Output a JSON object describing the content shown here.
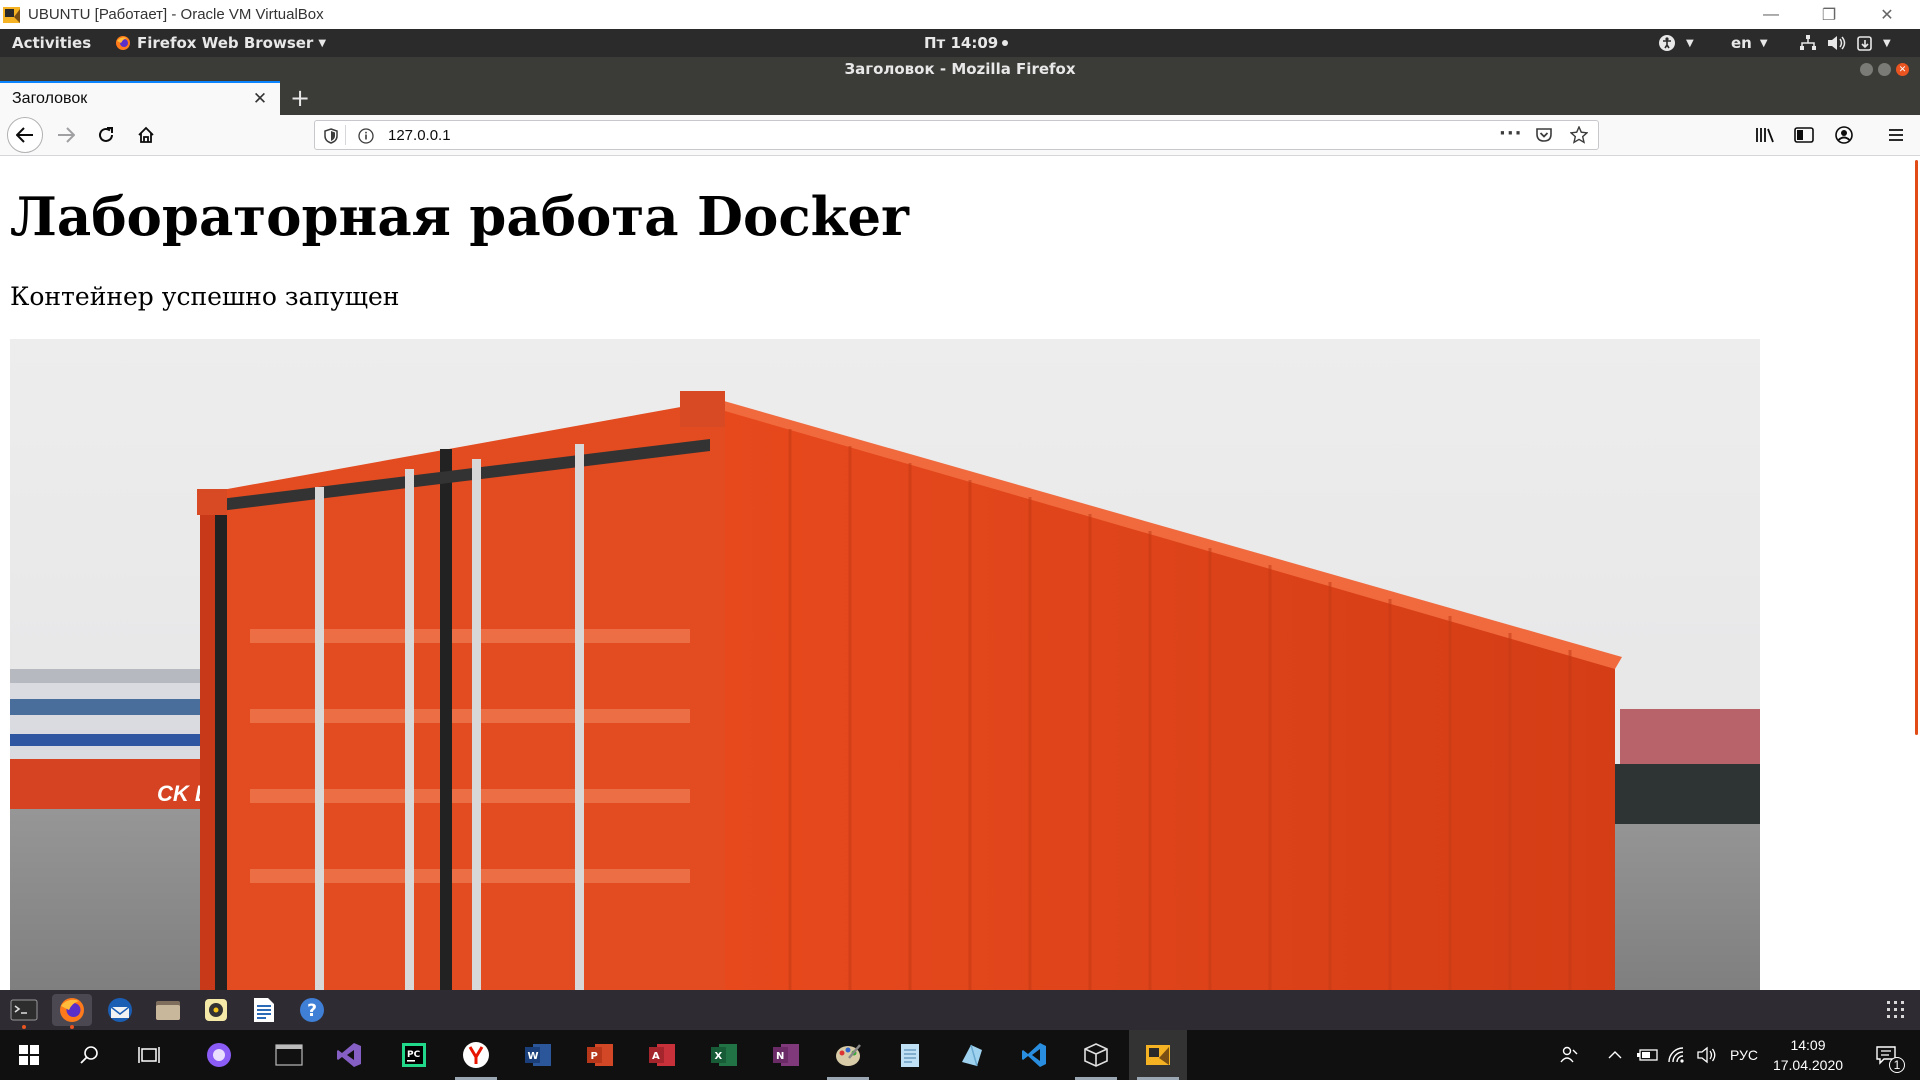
{
  "vbox": {
    "title": "UBUNTU [Работает] - Oracle VM VirtualBox",
    "minimize": "—",
    "restore": "❐",
    "close": "✕"
  },
  "gnome": {
    "activities": "Activities",
    "app_menu": "Firefox Web Browser",
    "clock": "Пт 14:09",
    "lang": "en"
  },
  "firefox": {
    "window_title": "Заголовок - Mozilla Firefox",
    "tab_title": "Заголовок",
    "url": "127.0.0.1"
  },
  "page": {
    "heading": "Лабораторная работа Docker",
    "subtitle": "Контейнер успешно запущен",
    "photo_caption": "CK L"
  },
  "taskbar": {
    "input_lang": "РУС",
    "time": "14:09",
    "date": "17.04.2020",
    "notification_count": "1"
  },
  "colors": {
    "firefox_accent": "#0a84ff",
    "container_orange": "#e2461c",
    "ubuntu_orange": "#e95420"
  }
}
